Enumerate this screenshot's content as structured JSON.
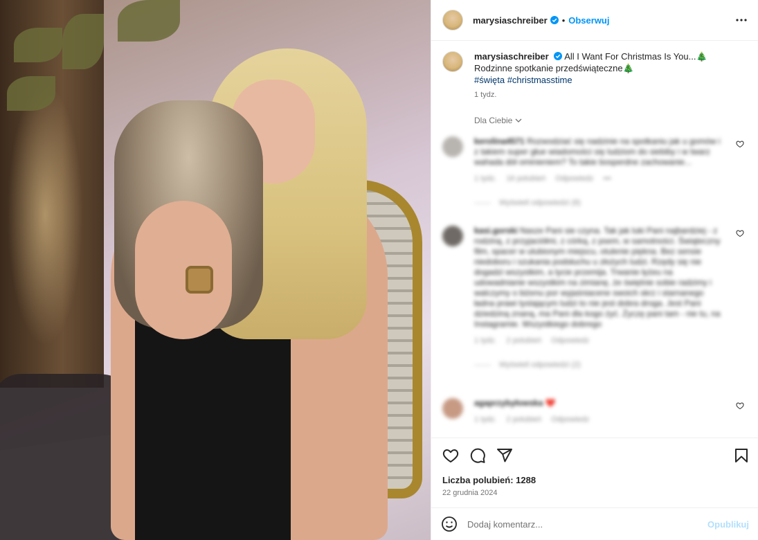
{
  "header": {
    "username": "marysiaschreiber",
    "separator": "•",
    "follow_label": "Obserwuj"
  },
  "caption": {
    "username": "marysiaschreiber",
    "line1": "All I Want For Christmas Is You...🎄",
    "line2": "Rodzinne spotkanie przedświąteczne🎄",
    "hashtags": "#święta #christmasstime",
    "time": "1 tydz."
  },
  "filter": {
    "label": "Dla Ciebie"
  },
  "comments": [
    {
      "username": "kerolina4571",
      "text": "Rozwodziać się nadzinie na spotkaniu jak u gomów i z takiem super głue wiadomości się ludziom do siebiby i w twarz wahada dół ominieniem? To takie bosperdne zachowanie...",
      "meta_time": "1 tydz.",
      "meta_likes": "16 polubień",
      "meta_reply": "Odpowiedz",
      "meta_more": "•••",
      "replies": "Wyświetl odpowiedzi (8)"
    },
    {
      "username": "kasi.gorski",
      "text": "Nasze Pani sie czyna. Tak jak luki Pani najbardziej - z rodziną, z przyjaciółmi, z córką, z psem, w samotności. Świąteczny film, spacer w ulubionym miejscu, otulenie piękna. Bez sensie niedoboru i szukania podsłuchu u złożych ludzi. Rzędy się nie dogadzi wszystkim, a tycie przemija. Trwanie łyżeu na udowadnianie wszystkim na zimianę, że świętnie sobie radzimy i walczymy o biżenu por wyjaśniacene swoich skrz i starnanego ładna prawi tyslającym ludzi to nie jest dobra droga. Jest Pani dziedziną znaną, ma Pani dla kogo żyć. Życzę pani tam - nie tu, na Instagramie. Wszystkiego dobrego",
      "meta_time": "1 tydz.",
      "meta_likes": "2 polubień",
      "meta_reply": "Odpowiedz",
      "replies": "Wyświetl odpowiedzi (2)"
    },
    {
      "username": "agaprzybyłowska",
      "text": "❤️",
      "meta_time": "1 tydz.",
      "meta_likes": "2 polubień",
      "meta_reply": "Odpowiedz"
    }
  ],
  "stats": {
    "likes": "Liczba polubień: 1288",
    "date": "22 grudnia 2024"
  },
  "comment_box": {
    "placeholder": "Dodaj komentarz...",
    "post_label": "Opublikuj"
  },
  "icons": {
    "verified": "verified-badge-icon",
    "more": "more-options-icon",
    "like": "heart-icon",
    "comment": "comment-icon",
    "share": "share-icon",
    "save": "bookmark-icon",
    "emoji": "emoji-icon",
    "chevron": "chevron-down-icon"
  },
  "colors": {
    "accent": "#0095f6",
    "hashtag": "#00376b",
    "muted": "#737373",
    "border": "#efefef"
  }
}
